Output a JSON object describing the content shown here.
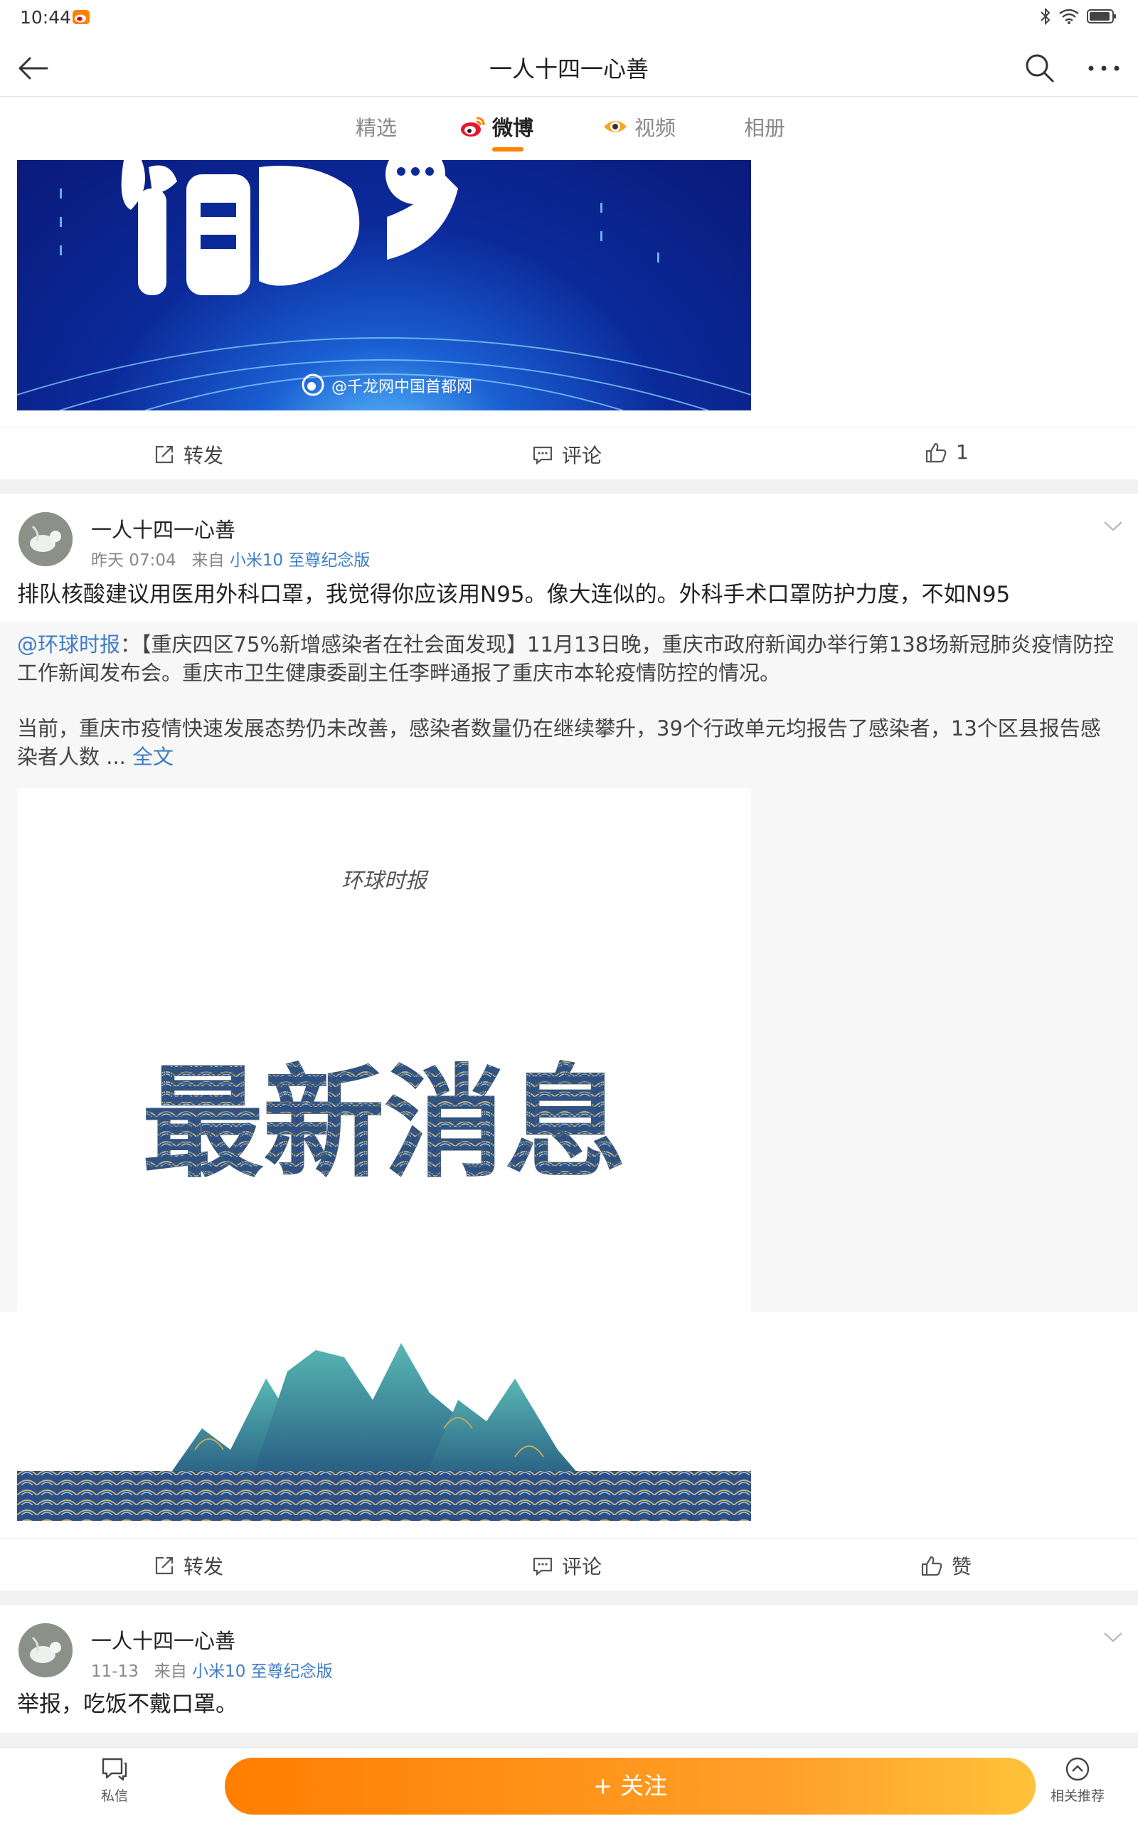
{
  "status_bar": {
    "time": "10:44"
  },
  "nav": {
    "title": "一人十四一心善"
  },
  "tabs": [
    {
      "label": "精选"
    },
    {
      "label": "微博"
    },
    {
      "label": "视频"
    },
    {
      "label": "相册"
    }
  ],
  "post0": {
    "image_watermark": "@千龙网中国首都网",
    "actions": {
      "repost": "转发",
      "comment": "评论",
      "like": "1"
    }
  },
  "post1": {
    "author": "一人十四一心善",
    "time": "昨天 07:04",
    "from_prefix": "来自",
    "source": "小米10 至尊纪念版",
    "text": "排队核酸建议用医用外科口罩，我觉得你应该用N95。像大连似的。外科手术口罩防护力度，不如N95",
    "repost": {
      "mention": "@环球时报",
      "colon": "：",
      "text1": "【重庆四区75%新增感染者在社会面发现】11月13日晚，重庆市政府新闻办举行第138场新冠肺炎疫情防控工作新闻发布会。重庆市卫生健康委副主任李畔通报了重庆市本轮疫情防控的情况。",
      "text2": "当前，重庆市疫情快速发展态势仍未改善，感染者数量仍在继续攀升，39个行政单元均报告了感染者，13个区县报告感染者人数",
      "ellipsis": " ... ",
      "full_text_link": "全文",
      "image_logo": "环球时报",
      "image_headline": "最新消息"
    },
    "actions": {
      "repost": "转发",
      "comment": "评论",
      "like": "赞"
    }
  },
  "post2": {
    "author": "一人十四一心善",
    "time": "11-13",
    "from_prefix": "来自",
    "source": "小米10 至尊纪念版",
    "text": "举报，吃饭不戴口罩。"
  },
  "bottom_bar": {
    "message": "私信",
    "follow": "+ 关注",
    "related": "相关推荐"
  },
  "colors": {
    "accent": "#ff8200",
    "link": "#3f7dc6"
  }
}
